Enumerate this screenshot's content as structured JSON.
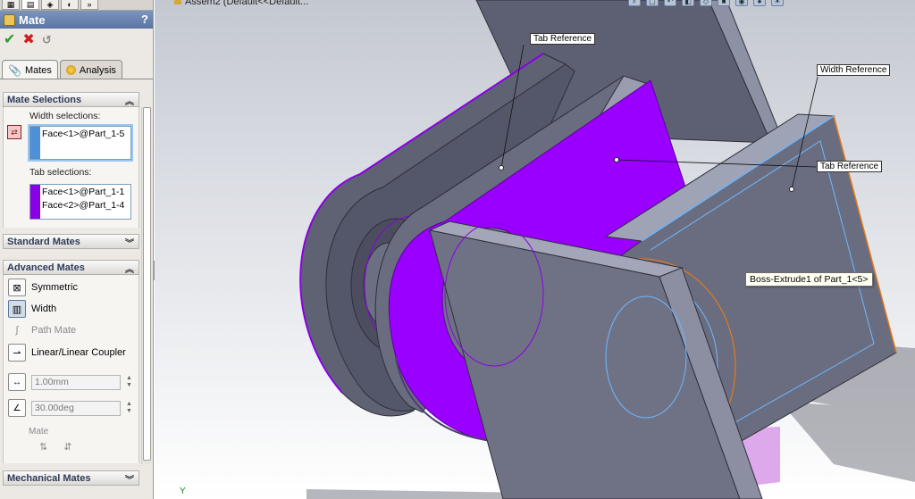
{
  "document": {
    "title": "Assem2 (Default<<Default..."
  },
  "property_manager": {
    "title": "Mate",
    "help_label": "?",
    "ok_icon": "check-icon",
    "cancel_icon": "x-icon",
    "pin_icon": "pushpin-icon",
    "tabs": [
      {
        "label": "Mates",
        "icon": "paperclip-icon",
        "active": true
      },
      {
        "label": "Analysis",
        "icon": "analysis-icon",
        "active": false
      }
    ],
    "mate_selections": {
      "header": "Mate Selections",
      "width_label": "Width selections:",
      "width_items": [
        "Face<1>@Part_1-5"
      ],
      "width_color": "#4f8fd8",
      "tab_label": "Tab selections:",
      "tab_items": [
        "Face<1>@Part_1-1",
        "Face<2>@Part_1-4"
      ],
      "tab_color": "#8a00e6"
    },
    "standard_mates": {
      "header": "Standard Mates"
    },
    "advanced_mates": {
      "header": "Advanced Mates",
      "items": [
        {
          "label": "Symmetric",
          "icon": "symmetric-icon"
        },
        {
          "label": "Width",
          "icon": "width-icon",
          "selected": true
        },
        {
          "label": "Path Mate",
          "icon": "path-mate-icon",
          "disabled": true
        },
        {
          "label": "Linear/Linear Coupler",
          "icon": "linear-coupler-icon"
        }
      ],
      "distance_value": "1.00mm",
      "angle_value": "30.00deg",
      "mate_alignment_label": "Mate"
    },
    "mechanical_mates": {
      "header": "Mechanical Mates"
    }
  },
  "viewport": {
    "callouts": {
      "tab_reference_1": "Tab Reference",
      "width_reference": "Width Reference",
      "tab_reference_2": "Tab Reference"
    },
    "tooltip": "Boss-Extrude1 of Part_1<5>",
    "triad_axis": "Y"
  },
  "colors": {
    "part_gray": "#6e7184",
    "part_edge": "#3a3b49",
    "tab_highlight": "#9a00ff",
    "width_highlight": "#6fb8ff",
    "hover_orange": "#e07a1a",
    "title_bar": "#5a75a3"
  }
}
